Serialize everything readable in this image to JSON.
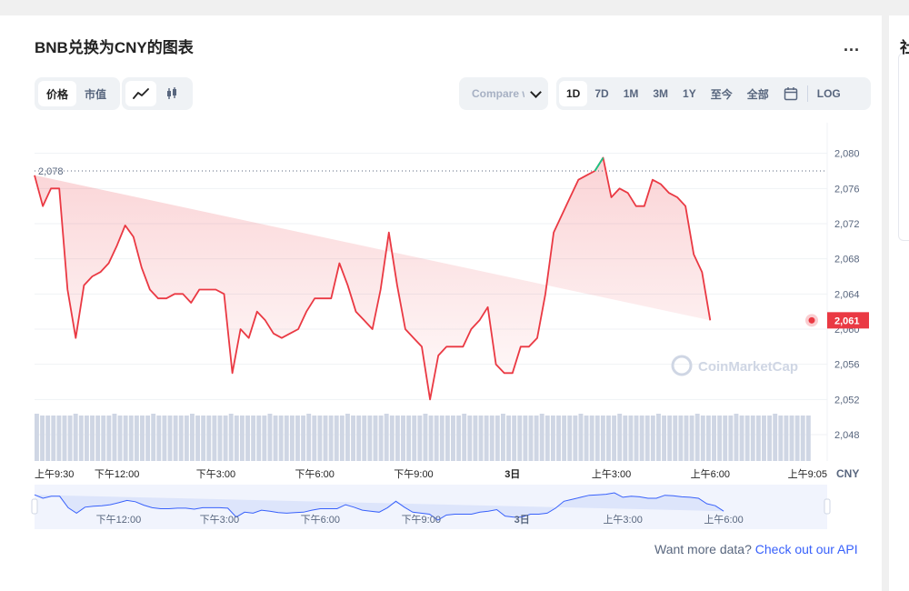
{
  "header": {
    "title": "BNB兑换为CNY的图表",
    "more_label": "...",
    "side_title": "社"
  },
  "controls": {
    "type_tabs": [
      {
        "label": "价格",
        "active": true
      },
      {
        "label": "市值",
        "active": false
      }
    ],
    "style_icons": [
      "line-chart-icon",
      "candlestick-icon"
    ],
    "compare_label": "Compare with",
    "range_tabs": [
      {
        "label": "1D",
        "active": true
      },
      {
        "label": "7D"
      },
      {
        "label": "1M"
      },
      {
        "label": "3M"
      },
      {
        "label": "1Y"
      },
      {
        "label": "至今"
      },
      {
        "label": "全部"
      }
    ],
    "calendar_icon": "calendar-icon",
    "log_label": "LOG"
  },
  "footer": {
    "text": "Want more data?",
    "link": "Check out our API"
  },
  "watermark": "CoinMarketCap",
  "colors": {
    "down": "#ea3943",
    "up": "#16c784",
    "volume": "#cfd6e4",
    "navigator_fill": "#dde5fb",
    "navigator_line": "#3861fb",
    "axis_text": "#58667e"
  },
  "chart_data": {
    "type": "line",
    "currency": "CNY",
    "reference_line": 2078,
    "last_value": 2061,
    "ylim": [
      2045,
      2084
    ],
    "y_ticks": [
      2048,
      2052,
      2056,
      2060,
      2064,
      2068,
      2072,
      2076,
      2080
    ],
    "x_ticks": [
      "上午9:30",
      "下午12:00",
      "下午3:00",
      "下午6:00",
      "下午9:00",
      "3日",
      "上午3:00",
      "上午6:00",
      "上午9:05"
    ],
    "x_tick_hours": [
      0,
      2.5,
      5.5,
      8.5,
      11.5,
      14.5,
      17.5,
      20.5,
      23.58
    ],
    "navigator_ticks": [
      "下午12:00",
      "下午3:00",
      "下午6:00",
      "下午9:00",
      "3日",
      "上午3:00",
      "上午6:00"
    ],
    "navigator_tick_hours": [
      2.5,
      5.5,
      8.5,
      11.5,
      14.5,
      17.5,
      20.5
    ],
    "x_hours": [
      0,
      0.25,
      0.5,
      0.75,
      1.0,
      1.25,
      1.5,
      1.75,
      2.0,
      2.25,
      2.5,
      2.75,
      3.0,
      3.25,
      3.5,
      3.75,
      4.0,
      4.25,
      4.5,
      4.75,
      5.0,
      5.25,
      5.5,
      5.75,
      6.0,
      6.25,
      6.5,
      6.75,
      7.0,
      7.25,
      7.5,
      7.75,
      8.0,
      8.25,
      8.5,
      8.75,
      9.0,
      9.25,
      9.5,
      9.75,
      10.0,
      10.25,
      10.5,
      10.75,
      11.0,
      11.25,
      11.5,
      11.75,
      12.0,
      12.25,
      12.5,
      12.75,
      13.0,
      13.25,
      13.5,
      13.75,
      14.0,
      14.25,
      14.5,
      14.75,
      15.0,
      15.25,
      15.5,
      15.75,
      16.0,
      16.25,
      16.5,
      16.75,
      17.0,
      17.25,
      17.5,
      17.75,
      18.0,
      18.25,
      18.5,
      18.75,
      19.0,
      19.25,
      19.5,
      19.75,
      20.0,
      20.25,
      20.5,
      20.75,
      21.0,
      21.25,
      21.5,
      21.75,
      22.0,
      22.25,
      22.5,
      22.75,
      23.0,
      23.25,
      23.5,
      23.58
    ],
    "prices": [
      2077.5,
      2074,
      2076,
      2076,
      2064.5,
      2059,
      2065,
      2066,
      2066.5,
      2067.5,
      2069.5,
      2071.8,
      2070.5,
      2067,
      2064.5,
      2063.5,
      2063.5,
      2064,
      2064,
      2063,
      2064.5,
      2064.5,
      2064.5,
      2064,
      2055,
      2060,
      2059,
      2062,
      2061,
      2059.5,
      2059,
      2059.5,
      2060,
      2062,
      2063.5,
      2063.5,
      2063.5,
      2067.5,
      2065,
      2062,
      2061,
      2060,
      2064.5,
      2071,
      2065,
      2060,
      2059,
      2058,
      2052,
      2057,
      2058,
      2058,
      2058,
      2060,
      2061,
      2062.5,
      2056,
      2055,
      2055,
      2058,
      2058,
      2059,
      2064,
      2071,
      2073,
      2075,
      2077,
      2077.5,
      2078,
      2079.5,
      2075,
      2076,
      2075.5,
      2074,
      2074,
      2077,
      2076.5,
      2075.5,
      2075,
      2074,
      2068.5,
      2066.5,
      2061
    ],
    "volume_series": "uniform",
    "grid": true,
    "legend": "none"
  }
}
